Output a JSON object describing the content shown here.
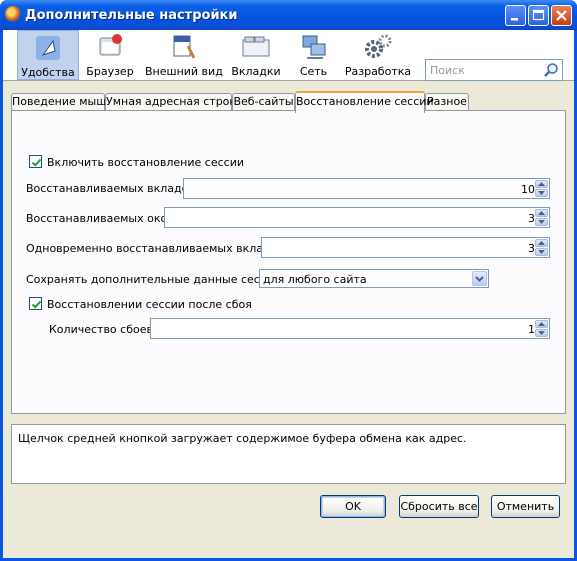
{
  "window": {
    "title": "Дополнительные настройки"
  },
  "toolbar": {
    "panes": [
      {
        "label": "Удобства",
        "icon": "usability-icon",
        "selected": true
      },
      {
        "label": "Браузер",
        "icon": "browser-icon",
        "selected": false
      },
      {
        "label": "Внешний вид",
        "icon": "appearance-icon",
        "selected": false
      },
      {
        "label": "Вкладки",
        "icon": "tabs-icon",
        "selected": false
      },
      {
        "label": "Сеть",
        "icon": "network-icon",
        "selected": false
      },
      {
        "label": "Разработка",
        "icon": "gears-icon",
        "selected": false
      }
    ]
  },
  "search": {
    "placeholder": "Поиск"
  },
  "tabs": [
    {
      "label": "Поведение мыши",
      "active": false
    },
    {
      "label": "Умная адресная строка",
      "active": false
    },
    {
      "label": "Веб-сайты",
      "active": false
    },
    {
      "label": "Восстановление сессии",
      "active": true
    },
    {
      "label": "Разное",
      "active": false
    }
  ],
  "session": {
    "enable_label": "Включить восстановление сессии",
    "enable_checked": true,
    "tabs_label": "Восстанавливаемых вкладок",
    "tabs_value": "10",
    "windows_label": "Восстанавливаемых окон",
    "windows_value": "3",
    "concurrent_label": "Одновременно восстанавливаемых вкладок",
    "concurrent_value": "3",
    "extra_label": "Сохранять дополнительные данные сессии",
    "extra_value": "для любого сайта",
    "crash_label": "Восстановлении сессии после сбоя",
    "crash_checked": true,
    "crash_count_label": "Количество сбоев",
    "crash_count_value": "1"
  },
  "description": "Щелчок средней кнопкой загружает содержимое буфера обмена как адрес.",
  "buttons": {
    "ok": "OK",
    "reset": "Сбросить все",
    "cancel": "Отменить"
  },
  "colors": {
    "titlebar": "#0454e0",
    "panel_bg": "#ece9d8",
    "selected_pane": "#c1d2ee",
    "active_tab_accent": "#f3a636"
  }
}
